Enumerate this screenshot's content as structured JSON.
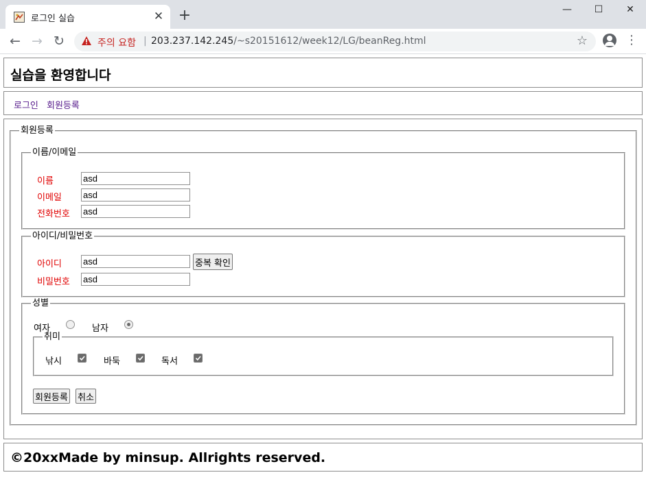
{
  "browser": {
    "tab_title": "로그인 실습",
    "security_label": "주의 요함",
    "url_host": "203.237.142.245",
    "url_path": "/~s20151612/week12/LG/beanReg.html"
  },
  "page": {
    "heading": "실습을 환영합니다",
    "nav": [
      "로그인",
      "회원등록"
    ],
    "footer": "©20xxMade by minsup. Allrights reserved."
  },
  "form": {
    "legend": "회원등록",
    "name_section": {
      "legend": "이름/이메일",
      "fields": [
        {
          "label": "이름",
          "value": "asd"
        },
        {
          "label": "이메일",
          "value": "asd"
        },
        {
          "label": "전화번호",
          "value": "asd"
        }
      ]
    },
    "account_section": {
      "legend": "아이디/비밀번호",
      "fields": [
        {
          "label": "아이디",
          "value": "asd"
        },
        {
          "label": "비밀번호",
          "value": "asd"
        }
      ],
      "check_button": "중복 확인"
    },
    "gender_section": {
      "legend": "성별",
      "options": [
        {
          "label": "여자",
          "checked": false
        },
        {
          "label": "남자",
          "checked": true
        }
      ],
      "hobby": {
        "legend": "취미",
        "items": [
          {
            "label": "낚시",
            "checked": true
          },
          {
            "label": "바둑",
            "checked": true
          },
          {
            "label": "독서",
            "checked": true
          }
        ]
      }
    },
    "submit_label": "회원등록",
    "cancel_label": "취소"
  },
  "colors": {
    "label_red": "#e00000",
    "link_visited": "#551a8b",
    "warning_red": "#c5221f"
  }
}
